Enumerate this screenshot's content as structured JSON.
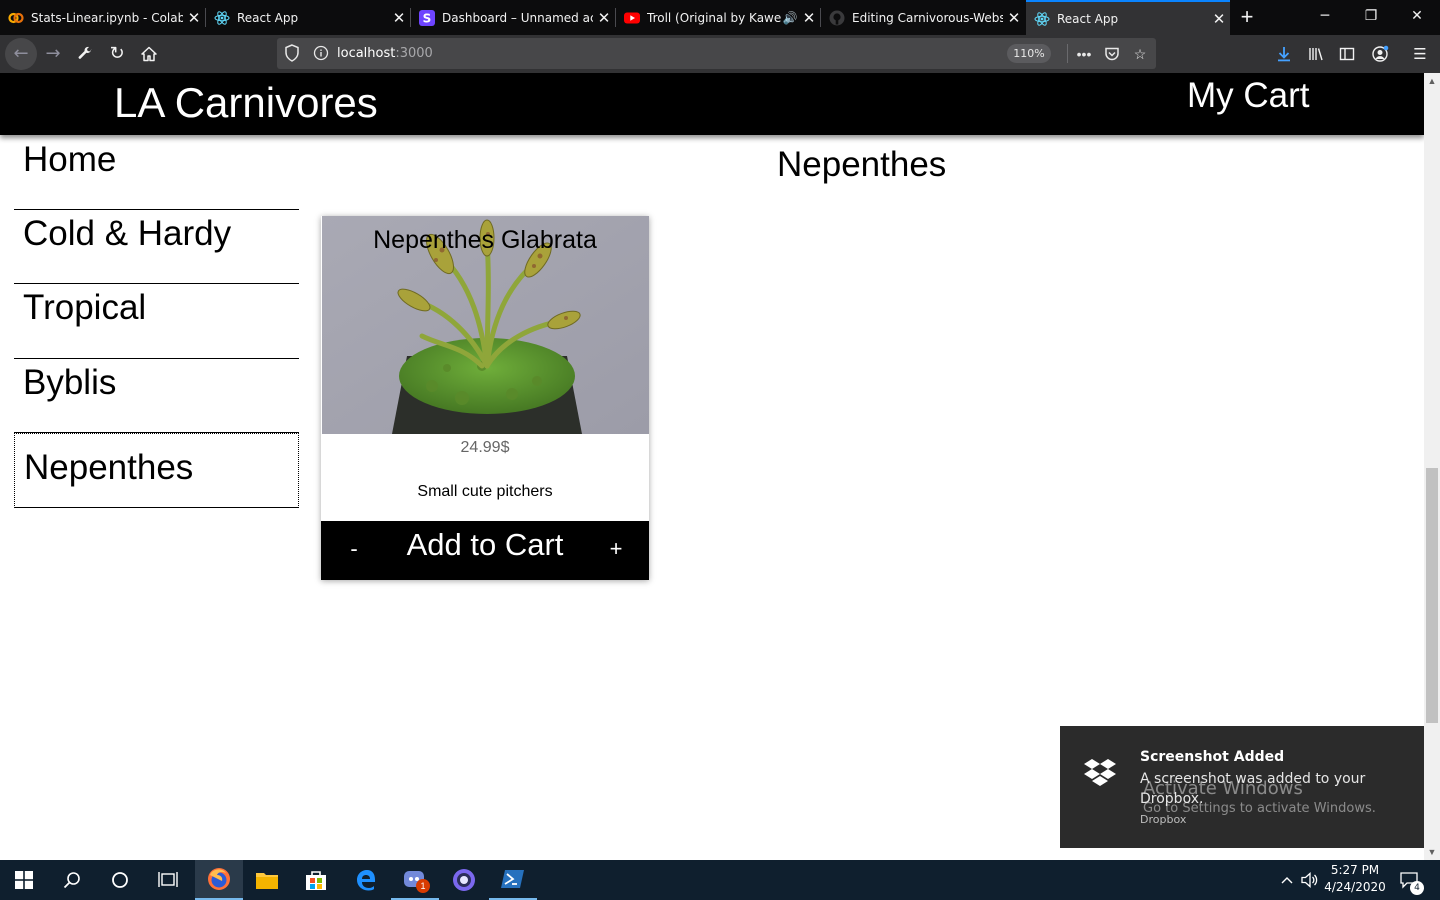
{
  "browser": {
    "tabs": [
      {
        "title": "Stats-Linear.ipynb - Colabo",
        "icon": "colab-icon"
      },
      {
        "title": "React App",
        "icon": "react-icon"
      },
      {
        "title": "Dashboard – Unnamed acc",
        "icon": "dashboard-icon"
      },
      {
        "title": "Troll (Original by Kaweh",
        "icon": "youtube-icon",
        "audio": "🔊"
      },
      {
        "title": "Editing Carnivorous-Websi",
        "icon": "github-icon"
      },
      {
        "title": "React App",
        "icon": "react-icon",
        "active": true
      }
    ],
    "url_host": "localhost",
    "url_port": ":3000",
    "zoom": "110%"
  },
  "site": {
    "brand": "LA Carnivores",
    "cart_link": "My Cart",
    "nav": [
      "Home",
      "Cold & Hardy",
      "Tropical",
      "Byblis",
      "Nepenthes"
    ],
    "active_nav": "Nepenthes",
    "category_title": "Nepenthes"
  },
  "product": {
    "name": "Nepenthes Glabrata",
    "price": "24.99$",
    "description": "Small cute pitchers",
    "add_label": "Add to Cart",
    "minus_label": "-",
    "plus_label": "+"
  },
  "toast": {
    "title": "Screenshot Added",
    "body": "A screenshot was added to your Dropbox.",
    "source": "Dropbox"
  },
  "watermark": {
    "line1": "Activate Windows",
    "line2": "Go to Settings to activate Windows."
  },
  "taskbar": {
    "time": "5:27 PM",
    "date": "4/24/2020",
    "discord_badge": "1",
    "notification_count": "4"
  },
  "colors": {
    "header": "#000000",
    "accent": "#0a84ff",
    "toast_bg": "#2b2b2b",
    "taskbar_bg": "#0f1f2e"
  }
}
